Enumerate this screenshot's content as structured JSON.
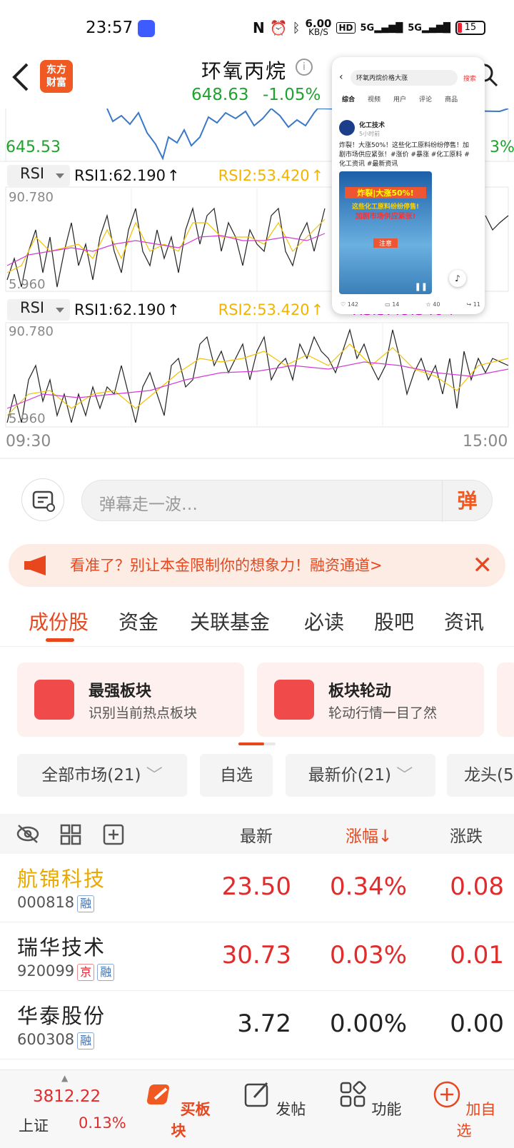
{
  "status_bar": {
    "time": "23:57",
    "net_speed": "6.00",
    "net_unit": "KB/S",
    "battery": "15"
  },
  "header": {
    "stock_name": "环氧丙烷",
    "price": "648.63",
    "change_pct": "-1.05%",
    "logo_text_1": "东方",
    "logo_text_2": "财富"
  },
  "chart": {
    "price_low_label": "645.53",
    "right_pct_label": "3%",
    "panels": [
      {
        "indicator": "RSI",
        "rsi1": "RSI1:62.190",
        "rsi2": "RSI2:53.420",
        "rsi3": "",
        "ymax": "90.780",
        "ymin": "5.960"
      },
      {
        "indicator": "RSI",
        "rsi1": "RSI1:62.190",
        "rsi2": "RSI2:53.420",
        "rsi3": "RSI3:49.340",
        "ymax": "90.780",
        "ymin": "5.960"
      }
    ],
    "time_start": "09:30",
    "time_end": "15:00"
  },
  "overlay": {
    "search_text": "环氧丙烷价格大涨",
    "search_btn": "搜索",
    "tabs": [
      "综合",
      "视频",
      "用户",
      "评论",
      "商品"
    ],
    "author": "化工技术",
    "time_ago": "5小时前",
    "post_text": "炸裂！大涨50%！这些化工原料纷纷停售！加剧市场供应紧张！#涨价 #暴涨 #化工原料 #化工资讯 #最新资讯",
    "image_title": "炸裂|大涨50%!",
    "image_sub1": "这些化工原料纷纷停售!",
    "image_sub2": "加剧市场供应紧张!",
    "image_note": "注意",
    "stats": [
      "142",
      "14",
      "40",
      "11"
    ]
  },
  "comment_bar": {
    "placeholder": "弹幕走一波…",
    "dan_button": "弹"
  },
  "banner": {
    "text": "看准了？别让本金限制你的想象力！融资通道>"
  },
  "tabs": [
    "成份股",
    "资金",
    "关联基金",
    "必读",
    "股吧",
    "资讯"
  ],
  "cards": [
    {
      "title": "最强板块",
      "subtitle": "识别当前热点板块"
    },
    {
      "title": "板块轮动",
      "subtitle": "轮动行情一目了然"
    }
  ],
  "filters": [
    "全部市场(21)",
    "自选",
    "最新价(21)",
    "龙头(5"
  ],
  "table": {
    "headers": {
      "latest": "最新",
      "change_pct": "涨幅↓",
      "change": "涨跌"
    },
    "rows": [
      {
        "name": "航锦科技",
        "code": "000818",
        "tags": [
          "融"
        ],
        "price": "23.50",
        "pct": "0.34%",
        "chg": "0.08",
        "color": "#e22b2b",
        "name_color": "#e8a900"
      },
      {
        "name": "瑞华技术",
        "code": "920099",
        "tags": [
          "京",
          "融"
        ],
        "price": "30.73",
        "pct": "0.03%",
        "chg": "0.01",
        "color": "#e22b2b",
        "name_color": "#222222"
      },
      {
        "name": "华泰股份",
        "code": "600308",
        "tags": [
          "融"
        ],
        "price": "3.72",
        "pct": "0.00%",
        "chg": "0.00",
        "color": "#222222",
        "name_color": "#222222"
      }
    ]
  },
  "bottom_bar": {
    "index_value": "3812.22",
    "index_name": "上证",
    "index_pct": "0.13%",
    "items": [
      "买板块",
      "发帖",
      "功能",
      "加自选"
    ]
  }
}
